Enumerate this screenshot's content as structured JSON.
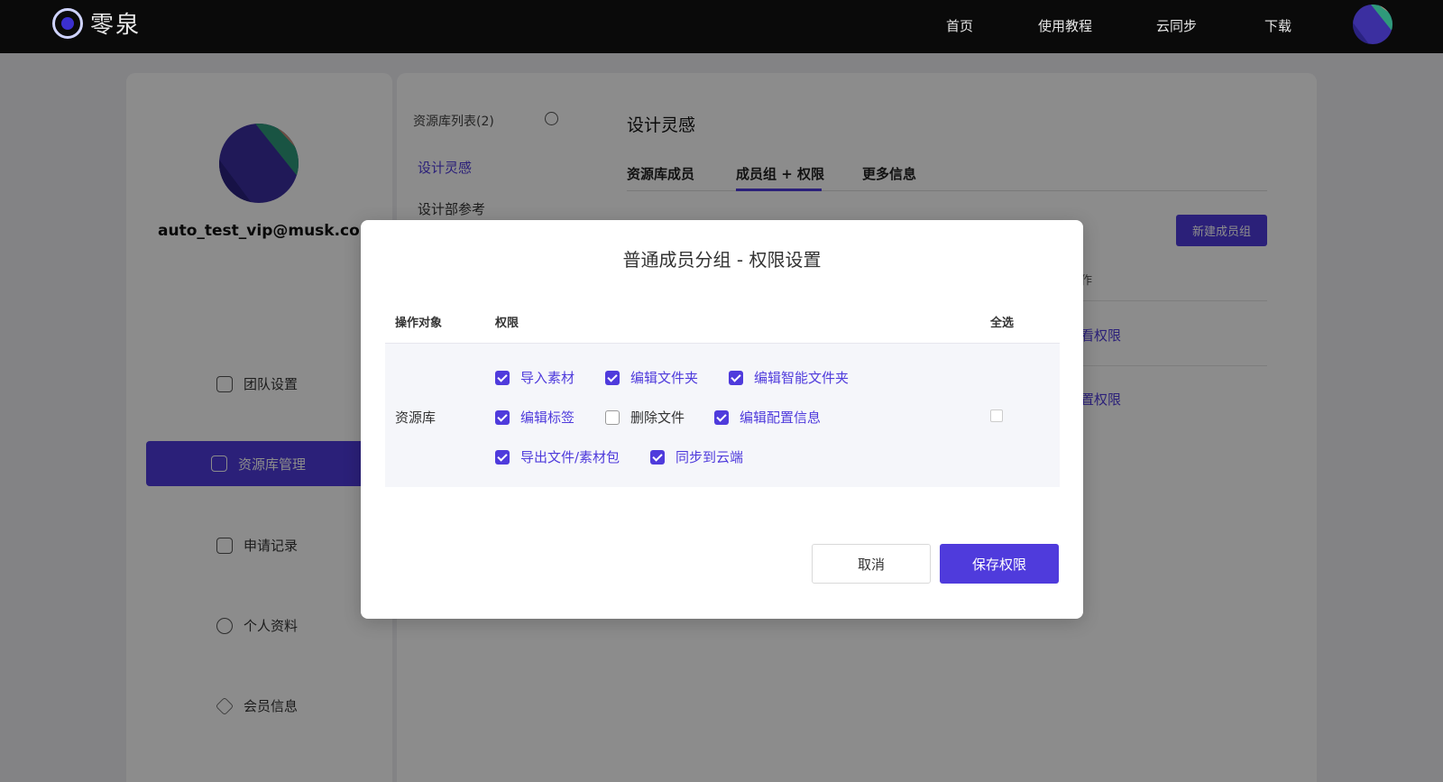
{
  "header": {
    "logo_text": "零泉",
    "nav": [
      "首页",
      "使用教程",
      "云同步",
      "下载"
    ]
  },
  "profile": {
    "email": "auto_test_vip@musk.com"
  },
  "sidebar": {
    "items": [
      {
        "label": "团队设置",
        "icon": "team-icon"
      },
      {
        "label": "资源库管理",
        "icon": "library-icon"
      },
      {
        "label": "申请记录",
        "icon": "inbox-icon"
      },
      {
        "label": "个人资料",
        "icon": "user-icon"
      },
      {
        "label": "会员信息",
        "icon": "diamond-icon"
      }
    ],
    "active_index": 1
  },
  "library_list": {
    "title": "资源库列表(2)",
    "items": [
      "设计灵感",
      "设计部参考"
    ]
  },
  "content": {
    "title": "设计灵感",
    "tabs": [
      "资源库成员",
      "成员组 + 权限",
      "更多信息"
    ],
    "active_tab": 1,
    "new_group_button": "新建成员组",
    "column_fragment": "作",
    "row_links": [
      "看权限",
      "置权限"
    ]
  },
  "modal": {
    "title": "普通成员分组 - 权限设置",
    "headers": {
      "object": "操作对象",
      "permission": "权限",
      "select_all": "全选"
    },
    "object": "资源库",
    "permissions": [
      {
        "label": "导入素材",
        "checked": true
      },
      {
        "label": "编辑文件夹",
        "checked": true
      },
      {
        "label": "编辑智能文件夹",
        "checked": true
      },
      {
        "label": "编辑标签",
        "checked": true
      },
      {
        "label": "删除文件",
        "checked": false
      },
      {
        "label": "编辑配置信息",
        "checked": true
      },
      {
        "label": "导出文件/素材包",
        "checked": true
      },
      {
        "label": "同步到云端",
        "checked": true
      }
    ],
    "cancel_label": "取消",
    "save_label": "保存权限"
  },
  "colors": {
    "accent": "#4f3bdc",
    "topbar": "#0a0a0a"
  }
}
